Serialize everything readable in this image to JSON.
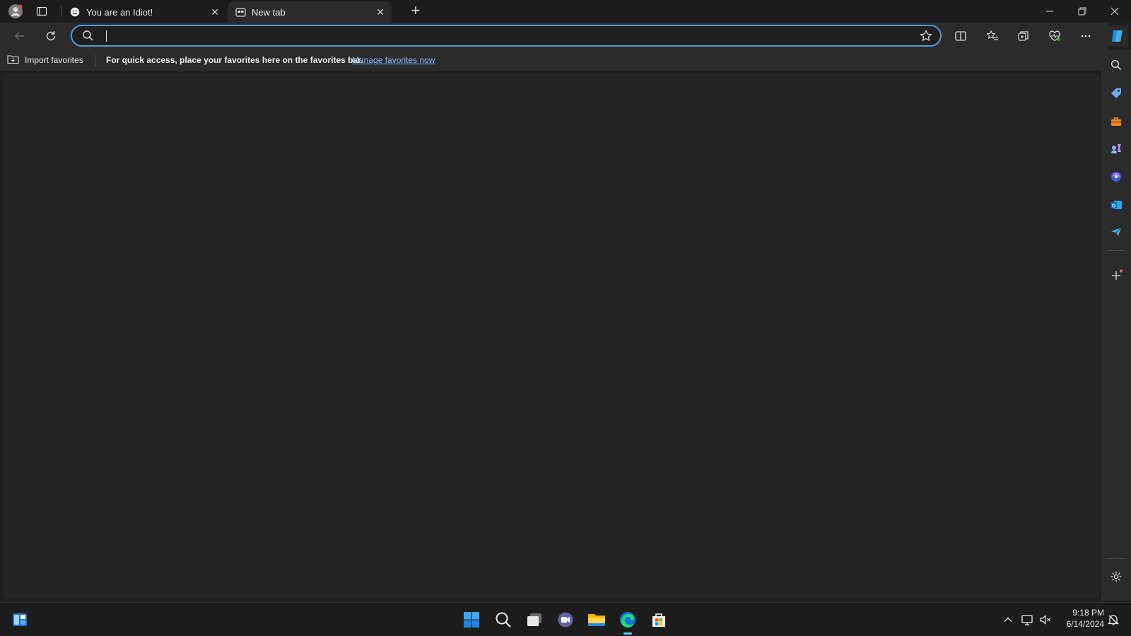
{
  "browser": {
    "tabs": [
      {
        "title": "You are an Idiot!",
        "active": false,
        "favicon": "smiley-icon"
      },
      {
        "title": "New tab",
        "active": true,
        "favicon": "newtab-page-icon"
      }
    ],
    "address_bar": {
      "value": "",
      "placeholder": ""
    },
    "favorites_bar": {
      "import_label": "Import favorites",
      "message": "For quick access, place your favorites here on the favorites bar.",
      "link_label": "Manage favorites now"
    }
  },
  "taskbar": {
    "apps": [
      "start-icon",
      "search-icon",
      "task-view-icon",
      "teams-chat-icon",
      "file-explorer-icon",
      "edge-icon",
      "store-icon"
    ],
    "clock": {
      "time": "9:18 PM",
      "date": "6/14/2024"
    }
  },
  "colors": {
    "accent": "#4f9bd5",
    "link": "#7fb7ff",
    "page_bg": "#252525"
  }
}
